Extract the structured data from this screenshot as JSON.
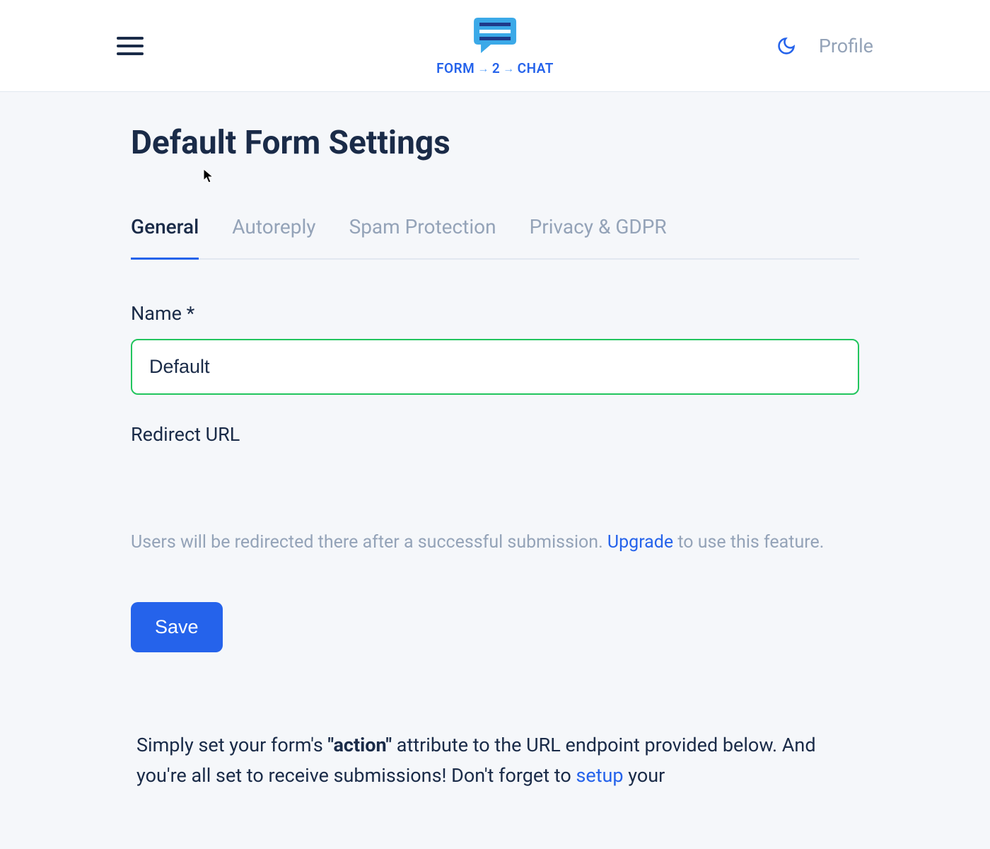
{
  "header": {
    "logo_word1": "FORM",
    "logo_num": "2",
    "logo_word2": "CHAT",
    "profile_label": "Profile"
  },
  "page": {
    "title": "Default Form Settings"
  },
  "tabs": [
    {
      "label": "General"
    },
    {
      "label": "Autoreply"
    },
    {
      "label": "Spam Protection"
    },
    {
      "label": "Privacy & GDPR"
    }
  ],
  "form": {
    "name_label": "Name *",
    "name_value": "Default",
    "redirect_label": "Redirect URL",
    "redirect_value": "",
    "redirect_help_prefix": "Users will be redirected there after a successful submission. ",
    "redirect_help_link": "Upgrade",
    "redirect_help_suffix": " to use this feature.",
    "save_label": "Save"
  },
  "info": {
    "part1": "Simply set your form's ",
    "action_word": "\"action\"",
    "part2": " attribute to the URL endpoint provided below. And you're all set to receive submissions! Don't forget to ",
    "setup_link": "setup",
    "part3": " your"
  }
}
